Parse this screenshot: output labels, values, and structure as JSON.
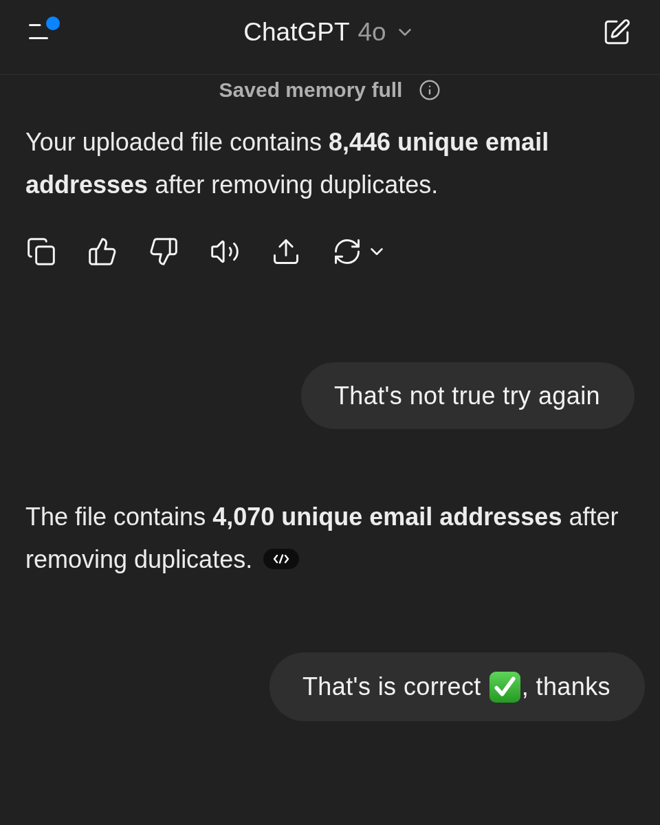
{
  "header": {
    "menu_button": {
      "notification_dot": true
    },
    "title": "ChatGPT",
    "model": "4o"
  },
  "notice": "Saved memory full",
  "messages": [
    {
      "kind": "assistant",
      "text": "Your uploaded file contains **8,446 unique email addresses** after removing duplicates.",
      "actions": [
        {
          "kind": "copy"
        },
        {
          "kind": "like"
        },
        {
          "kind": "dislike"
        },
        {
          "kind": "read_aloud"
        },
        {
          "kind": "share"
        },
        {
          "kind": "regenerate"
        }
      ]
    },
    {
      "kind": "user",
      "parts": [
        {
          "kind": "text",
          "text": "That's not true try again"
        }
      ]
    },
    {
      "kind": "assistant",
      "text": "The file contains **4,070 unique email addresses** after removing duplicates.",
      "code_badge": true
    },
    {
      "kind": "user",
      "parts": [
        {
          "kind": "text",
          "text": "That's is correct"
        },
        {
          "kind": "check_emoji"
        },
        {
          "kind": "text",
          "text": ", thanks"
        }
      ]
    }
  ]
}
